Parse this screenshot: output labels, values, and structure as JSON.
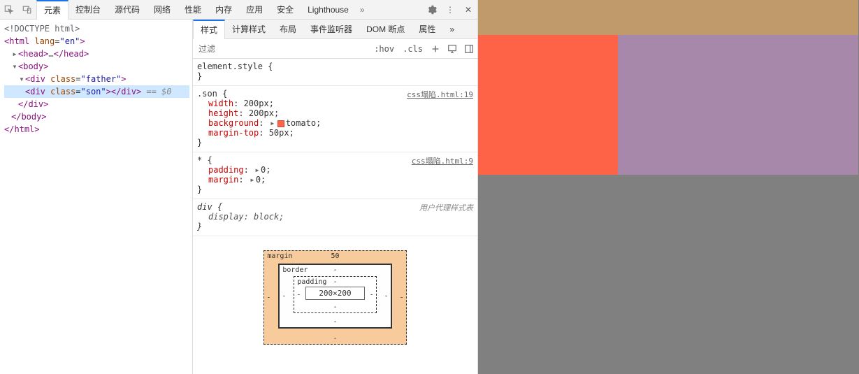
{
  "tabs": {
    "elements": "元素",
    "console": "控制台",
    "sources": "源代码",
    "network": "网络",
    "performance": "性能",
    "memory": "内存",
    "application": "应用",
    "security": "安全",
    "lighthouse": "Lighthouse",
    "more": "»"
  },
  "subtabs": {
    "styles": "样式",
    "computed": "计算样式",
    "layout": "布局",
    "listeners": "事件监听器",
    "dombreak": "DOM 断点",
    "props": "属性",
    "more": "»"
  },
  "filter": {
    "placeholder": "过滤",
    "hov": ":hov",
    "cls": ".cls"
  },
  "dom": {
    "doctype": "<!DOCTYPE html>",
    "html_open": "<html lang=\"en\">",
    "head": "<head>…</head>",
    "body_open": "<body>",
    "father_open": "<div class=\"father\">",
    "son": "<div class=\"son\"></div>",
    "son_eq": " == $0",
    "div_close": "</div>",
    "body_close": "</body>",
    "html_close": "</html>"
  },
  "rules": {
    "elementStyle": "element.style {",
    "close": "}",
    "son": {
      "selector": ".son {",
      "source": "css塌陷.html:19",
      "width": {
        "n": "width",
        "v": "200px"
      },
      "height": {
        "n": "height",
        "v": "200px"
      },
      "background": {
        "n": "background",
        "v": "tomato",
        "sw": "#ff6347"
      },
      "margintop": {
        "n": "margin-top",
        "v": "50px"
      }
    },
    "star": {
      "selector": "* {",
      "source": "css塌陷.html:9",
      "padding": {
        "n": "padding",
        "v": "0"
      },
      "margin": {
        "n": "margin",
        "v": "0"
      }
    },
    "div": {
      "selector": "div {",
      "ua": "用户代理样式表",
      "display": {
        "n": "display",
        "v": "block"
      }
    }
  },
  "box": {
    "margin_label": "margin",
    "border_label": "border",
    "padding_label": "padding",
    "margin_top": "50",
    "dash": "-",
    "content": "200×200"
  }
}
